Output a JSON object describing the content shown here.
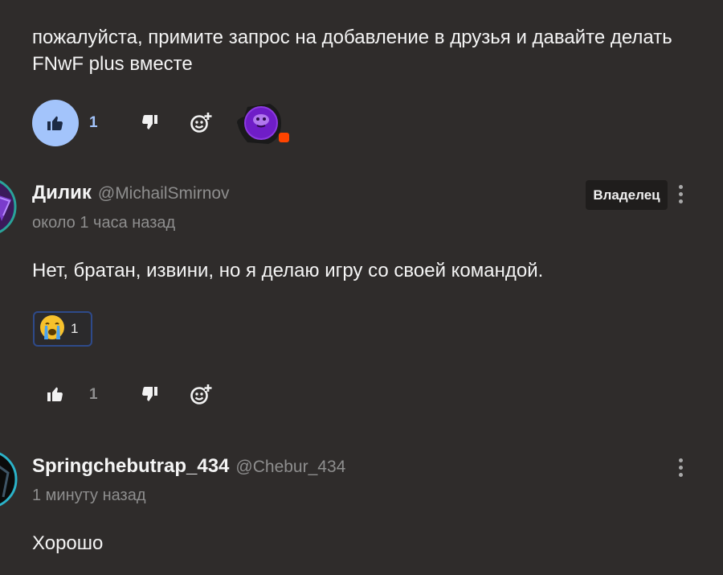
{
  "comment1": {
    "text": "пожалуйста, примите запрос на добавление в друзья и давайте делать FNwF plus вместе",
    "likes": "1"
  },
  "comment2": {
    "author": "Дилик",
    "handle": "@MichailSmirnov",
    "time": "около 1 часа назад",
    "badge": "Владелец",
    "text": "Нет, братан, извини, но я делаю игру со своей командой.",
    "reaction": {
      "emoji": "😭",
      "count": "1"
    },
    "likes": "1"
  },
  "comment3": {
    "author": "Springchebutrap_434",
    "handle": "@Chebur_434",
    "time": "1 минуту назад",
    "text": "Хорошо"
  },
  "colors": {
    "background": "#2f2c2b",
    "like_active": "#a3c4fb",
    "muted": "#8e8e8e",
    "notification": "#ff4400"
  }
}
